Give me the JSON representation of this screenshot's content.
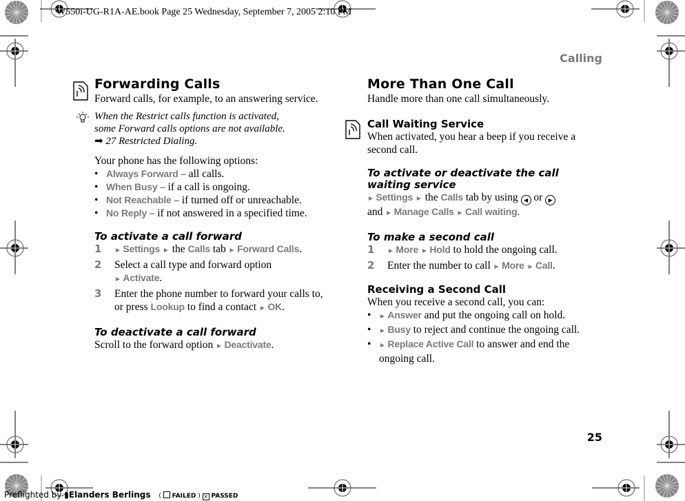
{
  "slug": "W550i-UG-R1A-AE.book  Page 25  Wednesday, September 7, 2005  2:10 PM",
  "running_head": "Calling",
  "page_number": "25",
  "left": {
    "title": "Forwarding Calls",
    "intro": "Forward calls, for example, to an answering service.",
    "tip": {
      "line1": "When the Restrict calls function is activated,",
      "line2": "some Forward calls options are not available.",
      "ref": "27 Restricted Dialing."
    },
    "options_intro": "Your phone has the following options:",
    "options": [
      {
        "label": "Always Forward –",
        "text": " all calls."
      },
      {
        "label": "When Busy –",
        "text": " if a call is ongoing."
      },
      {
        "label": "Not Reachable –",
        "text": " if turned off or unreachable."
      },
      {
        "label": "No Reply –",
        "text": " if not answered in a specified time."
      }
    ],
    "activate_heading": "To activate a call forward",
    "activate_steps": {
      "s1": {
        "num": "1",
        "m1": "Settings",
        "t1": " the ",
        "m2": "Calls",
        "t2": " tab ",
        "m3": "Forward Calls",
        "t3": "."
      },
      "s2": {
        "num": "2",
        "t1": "Select a call type and forward option",
        "m1": "Activate",
        "t2": "."
      },
      "s3": {
        "num": "3",
        "t1": "Enter the phone number to forward your calls to, or press ",
        "m1": "Lookup",
        "t2": " to find a contact ",
        "m2": "OK",
        "t3": "."
      }
    },
    "deactivate_heading": "To deactivate a call forward",
    "deactivate": {
      "t1": "Scroll to the forward option ",
      "m1": "Deactivate",
      "t2": "."
    }
  },
  "right": {
    "title": "More Than One Call",
    "intro": "Handle more than one call simultaneously.",
    "cw_heading": "Call Waiting Service",
    "cw_text": "When activated, you hear a beep if you receive a second call.",
    "cw_howto_heading": "To activate or deactivate the call waiting service",
    "cw_howto": {
      "m1": "Settings",
      "t1": " the ",
      "m2": "Calls",
      "t2": " tab by using ",
      "t3": " or ",
      "t4": "and ",
      "m3": "Manage Calls",
      "m4": "Call waiting."
    },
    "second_heading": "To make a second call",
    "second_steps": {
      "s1": {
        "num": "1",
        "m1": "More",
        "m2": "Hold",
        "t1": " to hold the ongoing call."
      },
      "s2": {
        "num": "2",
        "t1": "Enter the number to call ",
        "m1": "More",
        "m2": "Call",
        "t2": "."
      }
    },
    "receiving_heading": "Receiving a Second Call",
    "receiving_intro": "When you receive a second call, you can:",
    "receiving_options": [
      {
        "label": "Answer",
        "text": " and put the ongoing call on hold."
      },
      {
        "label": "Busy",
        "text": " to reject and continue the ongoing call."
      },
      {
        "label": "Replace Active Call",
        "text": " to answer and end the ongoing call."
      }
    ]
  },
  "footer": {
    "preflighted": "Preflighted by",
    "company": "Elanders Berlings",
    "failed": "FAILED",
    "passed": "PASSED"
  },
  "colors": {
    "menu_gray": "#7a7a7a",
    "text": "#000000"
  }
}
